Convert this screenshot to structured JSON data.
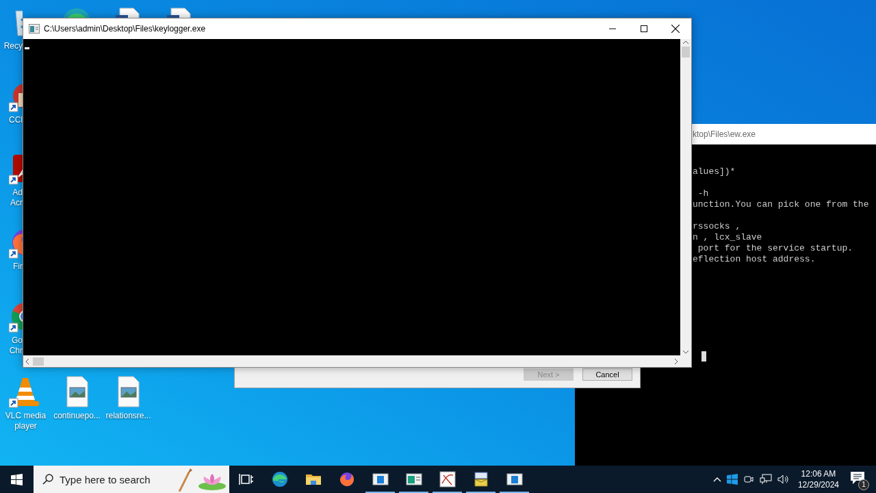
{
  "desktop_icons": [
    {
      "kind": "recycle-bin",
      "label": [
        "Recy"
      ]
    },
    {
      "kind": "edge"
    },
    {
      "kind": "word-doc"
    },
    {
      "kind": "word-doc"
    },
    {
      "kind": "ccleaner",
      "shortcut": true,
      "label": [
        "CCl"
      ]
    },
    {
      "kind": "acrobat",
      "shortcut": true,
      "label": [
        "Ad",
        "Acr"
      ]
    },
    {
      "kind": "firefox",
      "shortcut": true,
      "label": [
        "Fir"
      ]
    },
    {
      "kind": "chrome",
      "shortcut": true,
      "label": [
        "Go",
        "Chr"
      ]
    },
    {
      "kind": "vlc",
      "shortcut": true,
      "label": [
        "VLC media",
        "player"
      ]
    },
    {
      "kind": "image-file",
      "label": [
        "continuepo..."
      ]
    },
    {
      "kind": "image-file",
      "label": [
        "relationsre..."
      ]
    }
  ],
  "background_console": {
    "title": "ktop\\Files\\ew.exe",
    "blocks": [
      [
        "alues])*"
      ],
      [
        " -h",
        "unction.You can pick one from the"
      ],
      [
        "rssocks ,",
        "n , lcx_slave",
        " port for the service startup.",
        "eflection host address."
      ]
    ]
  },
  "wizard": {
    "buttons": [
      {
        "label": "Next >",
        "disabled": true
      },
      {
        "label": "Cancel",
        "disabled": false
      }
    ]
  },
  "main_window": {
    "title": "C:\\Users\\admin\\Desktop\\Files\\keylogger.exe"
  },
  "taskbar": {
    "search": {
      "placeholder": "Type here to search"
    },
    "apps": [
      {
        "kind": "task-view",
        "running": false
      },
      {
        "kind": "edge",
        "running": false
      },
      {
        "kind": "folder",
        "running": false
      },
      {
        "kind": "firefox",
        "running": false
      },
      {
        "kind": "console-app",
        "running": true
      },
      {
        "kind": "form-app",
        "running": true
      },
      {
        "kind": "sketch-app",
        "running": true
      },
      {
        "kind": "installer",
        "running": true
      },
      {
        "kind": "console-app",
        "running": true
      }
    ],
    "tray": {
      "time": "12:06 AM",
      "date": "12/29/2024",
      "notification_count": "1"
    }
  }
}
